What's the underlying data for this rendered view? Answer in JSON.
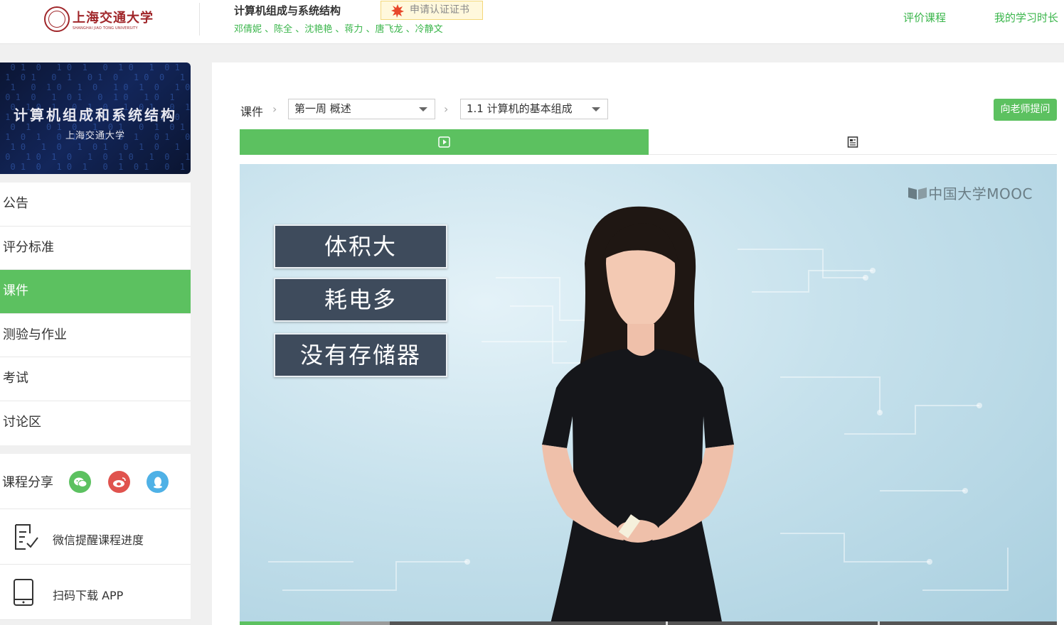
{
  "header": {
    "logo_cn": "上海交通大学",
    "logo_en": "SHANGHAI JIAO TONG UNIVERSITY",
    "course_title": "计算机组成与系统结构",
    "teachers": "邓倩妮 、陈全 、沈艳艳 、蒋力 、唐飞龙 、冷静文",
    "certificate_label": "申请认证证书",
    "links": [
      "评价课程",
      "我的学习时长"
    ]
  },
  "banner": {
    "title": "计算机组成和系统结构",
    "subtitle": "上海交通大学"
  },
  "menu": {
    "items": [
      "公告",
      "评分标准",
      "课件",
      "测验与作业",
      "考试",
      "讨论区"
    ],
    "active_index": 2
  },
  "share": {
    "label": "课程分享",
    "icons": [
      "wechat-icon",
      "weibo-icon",
      "qq-icon"
    ],
    "colors": {
      "wechat": "#5cc160",
      "weibo": "#e0534e",
      "qq": "#4fb1e6"
    }
  },
  "utilities": {
    "wechat_reminder": "微信提醒课程进度",
    "download_app": "扫码下载 APP"
  },
  "breadcrumb": {
    "root": "课件",
    "week_select": "第一周 概述",
    "lesson_select": "1.1 计算机的基本组成"
  },
  "ask_teacher_label": "向老师提问",
  "tabs": [
    "video",
    "document"
  ],
  "video": {
    "watermark": "中国大学MOOC",
    "keywords": [
      "体积大",
      "耗电多",
      "没有存储器"
    ],
    "progress_percent": 12.3
  },
  "colors": {
    "accent": "#5cc160",
    "link": "#39b54a",
    "brand_red": "#a0262a"
  }
}
